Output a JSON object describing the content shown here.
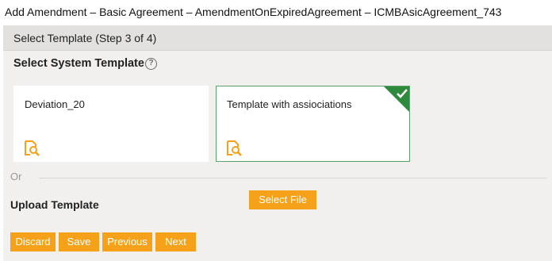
{
  "window": {
    "title": "Add Amendment – Basic Agreement – AmendmentOnExpiredAgreement – ICMBAsicAgreement_743"
  },
  "wizard": {
    "step_title": "Select Template (Step 3 of 4)",
    "section_title": "Select System Template",
    "help_icon": "help-circle-icon",
    "help_glyph": "?"
  },
  "templates": [
    {
      "name": "Deviation_20",
      "selected": false,
      "icon": "preview-search-icon"
    },
    {
      "name": "Template with assiociations",
      "selected": true,
      "icon": "preview-search-icon"
    }
  ],
  "divider": {
    "label": "Or"
  },
  "upload": {
    "label": "Upload Template",
    "button_label": "Select File"
  },
  "footer": {
    "discard_label": "Discard",
    "save_label": "Save",
    "previous_label": "Previous",
    "next_label": "Next"
  },
  "colors": {
    "accent": "#f5a21a",
    "selected_border": "#5aa06a",
    "check_badge": "#2f8a3e",
    "panel_bg": "#f1f0ef",
    "step_bar_bg": "#e2e1e0"
  }
}
